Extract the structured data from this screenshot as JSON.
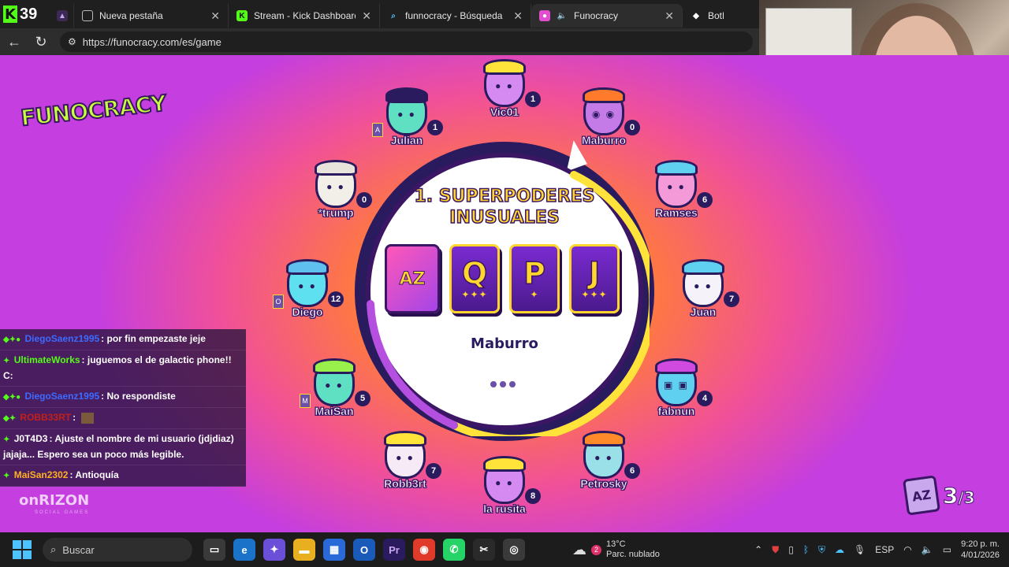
{
  "browser": {
    "kick_counter": "39",
    "tabs": [
      {
        "title": "Nueva pestaña",
        "icon": "page-icon"
      },
      {
        "title": "Stream - Kick Dashboard",
        "icon": "kick-icon"
      },
      {
        "title": "funnocracy - Búsqueda",
        "icon": "search-icon"
      },
      {
        "title": "Funocracy",
        "icon": "funocracy-icon",
        "active": true
      },
      {
        "title": "BotRix |",
        "icon": "botrix-icon"
      }
    ],
    "url": "https://funocracy.com/es/game"
  },
  "game": {
    "logo": "FUNOCRACY",
    "prompt": "1. SUPERPODERES INUSUALES",
    "cards": [
      {
        "kind": "az",
        "label": "AZ"
      },
      {
        "kind": "letter",
        "label": "Q",
        "stars": "✦✦✦"
      },
      {
        "kind": "letter",
        "label": "P",
        "stars": "✦"
      },
      {
        "kind": "letter",
        "label": "J",
        "stars": "✦✦✦"
      }
    ],
    "current_player": "Maburro",
    "players": [
      {
        "name": "Vic01",
        "score": "1"
      },
      {
        "name": "Julian",
        "score": "1",
        "tag": "A"
      },
      {
        "name": "Maburro",
        "score": "0"
      },
      {
        "name": "*trump",
        "score": "0"
      },
      {
        "name": "Ramses",
        "score": "6"
      },
      {
        "name": "Diego",
        "score": "12",
        "tag": "O"
      },
      {
        "name": "Juan",
        "score": "7"
      },
      {
        "name": "MaiSan",
        "score": "5",
        "tag": "M"
      },
      {
        "name": "fabnun",
        "score": "4"
      },
      {
        "name": "Robb3rt",
        "score": "7"
      },
      {
        "name": "Petrosky",
        "score": "6"
      },
      {
        "name": "la rusita",
        "score": "8"
      }
    ],
    "round": {
      "current": "3",
      "total": "/3"
    },
    "brand": "onRIZON",
    "brand_sub": "SOCIAL GAMES"
  },
  "chat": [
    {
      "user": "DiegoSaenz1995",
      "user_color": "#3b6bff",
      "msg": ": por fin empezaste jeje"
    },
    {
      "user": "UltimateWorks",
      "user_color": "#53fc18",
      "msg": ": juguemos el de galactic phone!! C:"
    },
    {
      "user": "DiegoSaenz1995",
      "user_color": "#3b6bff",
      "msg": ": No respondiste"
    },
    {
      "user": "ROBB33RT",
      "user_color": "#c0201a",
      "msg": ":"
    },
    {
      "user": "J0T4D3",
      "user_color": "#ffffff",
      "msg": ": Ajuste el nombre de mi usuario (jdjdiaz) jajaja... Espero sea un poco más legible."
    },
    {
      "user": "MaiSan2302",
      "user_color": "#ffb020",
      "msg": ": Antioquía"
    }
  ],
  "taskbar": {
    "search_placeholder": "Buscar",
    "weather_temp": "13°C",
    "weather_desc": "Parc. nublado",
    "weather_badge": "2",
    "lang": "ESP",
    "time": "9:20 p. m.",
    "date": "4/01/2026"
  }
}
